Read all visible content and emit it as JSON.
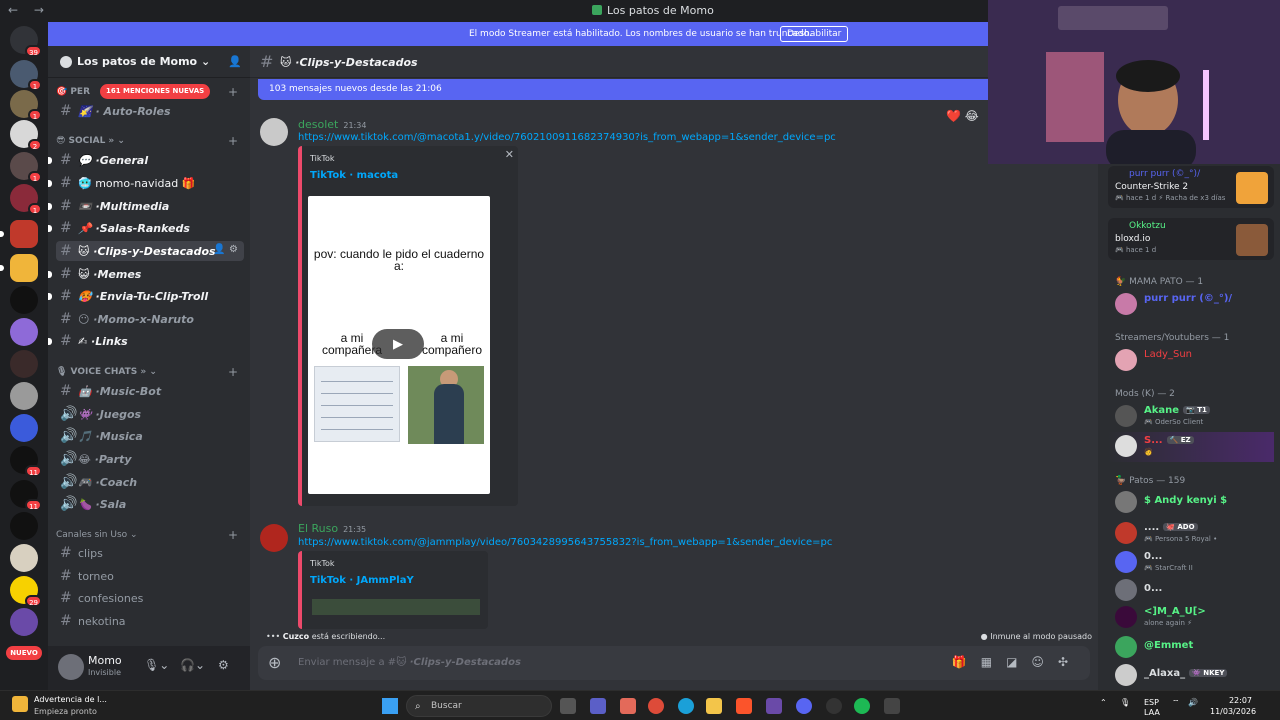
{
  "window": {
    "title": "Los patos de Momo",
    "nav": "← →"
  },
  "streamer_banner": {
    "text": "El modo Streamer está habilitado. Los nombres de usuario se han truncado.",
    "button": "Deshabilitar"
  },
  "server_rail": {
    "badges": [
      "39",
      "1",
      "1",
      "2",
      "1",
      "1",
      "1",
      "11",
      "11",
      "29"
    ],
    "new_label": "NUEVO"
  },
  "guild": {
    "name": "Los patos de Momo ⌄",
    "mentions_badge": "161 MENCIONES NUEVAS"
  },
  "categories": {
    "perfil": "🎯 PER",
    "social": "😎 SOCIAL » ⌄",
    "voice": "🎙 VOICE CHATS » ⌄",
    "unused": "Canales sin Uso ⌄"
  },
  "channels": [
    {
      "label": "🌠 · Auto-Roles",
      "kind": "normal"
    },
    {
      "label": "💬 ·General",
      "kind": "unread"
    },
    {
      "label": "🥶 momo-navidad 🎁",
      "kind": "unread-plain"
    },
    {
      "label": "📼 ·Multimedia",
      "kind": "unread"
    },
    {
      "label": "📌 ·Salas-Rankeds",
      "kind": "unread"
    },
    {
      "label": "🐱 ·Clips-y-Destacados",
      "kind": "active"
    },
    {
      "label": "😺 ·Memes",
      "kind": "unread"
    },
    {
      "label": "🥵 ·Envia-Tu-Clip-Troll",
      "kind": "unread"
    },
    {
      "label": "😶 ·Momo-x-Naruto",
      "kind": "normal"
    },
    {
      "label": "✍ ·Links",
      "kind": "unread"
    }
  ],
  "voice_channels": [
    "🤖 ·Music-Bot",
    "👾 ·Juegos",
    "🎵 ·Musica",
    "😂 ·Party",
    "🎮 ·Coach",
    "🍆 ·Sala"
  ],
  "unused_channels": [
    "clips",
    "torneo",
    "confesiones",
    "nekotina"
  ],
  "user": {
    "name": "Momo",
    "status": "Invisible"
  },
  "channel_header": {
    "name": "🐱 ·Clips-y-Destacados"
  },
  "new_messages_bar": "103 mensajes nuevos desde las 21:06",
  "messages": [
    {
      "author": "desolet",
      "author_color": "#dbdee1",
      "time": "21:34",
      "link": "https://www.tiktok.com/@macota1.y/video/7602100911682374930?is_from_webapp=1&sender_device=pc",
      "embed": {
        "provider": "TikTok",
        "title": "TikTok · macota",
        "video": {
          "caption": "pov: cuando le pido el cuaderno a:",
          "left_label": "a mi compañera",
          "right_label": "a mi compañero"
        }
      }
    },
    {
      "author": "El Ruso",
      "author_color": "#dbdee1",
      "time": "21:35",
      "link": "https://www.tiktok.com/@jammplay/video/7603428995643755832?is_from_webapp=1&sender_device=pc",
      "embed": {
        "provider": "TikTok",
        "title": "TikTok · JAmmPlaY"
      }
    }
  ],
  "reactions": "❤️ 😂",
  "typing": {
    "user": "Cuzco",
    "text": "está escribiendo..."
  },
  "immune": "Inmune al modo pausado",
  "composer": {
    "placeholder_prefix": "Enviar mensaje a #🐱 ",
    "placeholder_channel": "·Clips-y-Destacados"
  },
  "activities": [
    {
      "name": "purr purr (©_°)/",
      "game": "Counter-Strike 2",
      "meta": "🎮 hace 1 d   ⚡ Racha de x3 días"
    },
    {
      "name": "Okkotzu",
      "game": "bloxd.io",
      "meta": "🎮 hace 1 d"
    }
  ],
  "member_groups": [
    {
      "title": "🐓 MAMA PATO — 1",
      "members": [
        {
          "name": "purr purr (©_°)/",
          "color": "#5865f2",
          "sub": ""
        }
      ]
    },
    {
      "title": "Streamers/Youtubers — 1",
      "members": [
        {
          "name": "Lady_Sun",
          "color": "#f23f43",
          "sub": ""
        }
      ]
    },
    {
      "title": "Mods (K) — 2",
      "members": [
        {
          "name": "Akane",
          "color": "#57f287",
          "tag": "📷 T1",
          "sub": "🎮 OderSo Client"
        },
        {
          "name": "S...",
          "color": "#f23f43",
          "tag": "🔨 EZ",
          "sub": "🧑"
        }
      ]
    },
    {
      "title": "🦆 Patos — 159",
      "members": [
        {
          "name": "$ Andy kenyi $",
          "color": "#57f287",
          "sub": ""
        },
        {
          "name": "....",
          "color": "#f2f3f5",
          "tag": "🐙 ADO",
          "sub": "🎮 Persona 5 Royal •"
        },
        {
          "name": "0...",
          "color": "#f2f3f5",
          "sub": "🎮 StarCraft II"
        },
        {
          "name": "0...",
          "color": "#f2f3f5",
          "sub": ""
        },
        {
          "name": "<]M_A_U[>",
          "color": "#57f287",
          "sub": "alone again ⚡"
        },
        {
          "name": "@Emmet",
          "color": "#57f287",
          "sub": ""
        },
        {
          "name": "_Alaxa_",
          "color": "#f2f3f5",
          "tag": "👾 NKEY",
          "sub": ""
        }
      ]
    }
  ],
  "taskbar": {
    "alert_title": "Advertencia de l...",
    "alert_sub": "Empieza pronto",
    "search": "Buscar",
    "lang_top": "ESP",
    "lang_bottom": "LAA",
    "time": "22:07",
    "date": "11/03/2026"
  },
  "colors": {
    "accent": "#5865f2",
    "danger": "#f23f43",
    "link": "#00a8fc",
    "embed_border": "#ed4a6b"
  }
}
